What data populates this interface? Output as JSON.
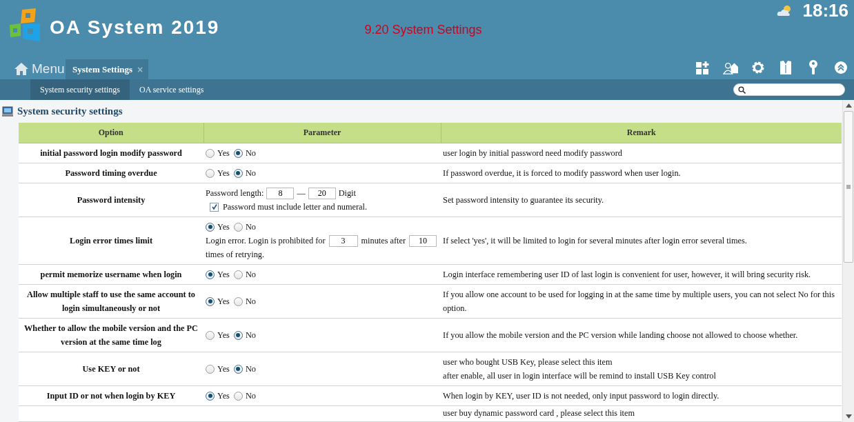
{
  "header": {
    "title": "OA System 2019",
    "page_title": "9.20 System Settings",
    "clock": "18:16"
  },
  "menu": {
    "label": "Menu"
  },
  "tabs": [
    {
      "label": "System Settings",
      "selected": true,
      "close": "×"
    }
  ],
  "subnav": [
    {
      "label": "System security settings",
      "selected": true
    },
    {
      "label": "OA service settings",
      "selected": false
    }
  ],
  "section": {
    "title": "System security settings"
  },
  "table": {
    "columns": [
      "Option",
      "Parameter",
      "Remark"
    ],
    "rows": [
      {
        "kind": "radio",
        "option": "initial password login modify password",
        "choices": [
          {
            "label": "Yes",
            "selected": false
          },
          {
            "label": "No",
            "selected": true
          }
        ],
        "remark": [
          "user login by initial password need modify password"
        ]
      },
      {
        "kind": "radio",
        "option": "Password timing overdue",
        "choices": [
          {
            "label": "Yes",
            "selected": false
          },
          {
            "label": "No",
            "selected": true
          }
        ],
        "remark": [
          "If password overdue, it is forced to modify password when user login."
        ]
      },
      {
        "kind": "length",
        "option": "Password intensity",
        "label": "Password length:",
        "min": "8",
        "dash": "—",
        "max": "20",
        "unit": "Digit",
        "check": {
          "label": "Password must include letter and numeral.",
          "checked": true
        },
        "remark": [
          "Set password intensity to guarantee its security."
        ]
      },
      {
        "kind": "limit",
        "option": "Login error times limit",
        "choices": [
          {
            "label": "Yes",
            "selected": true
          },
          {
            "label": "No",
            "selected": false
          }
        ],
        "text_before": "Login error. Login is prohibited for",
        "minutes": "3",
        "text_middle": "minutes after",
        "times": "10",
        "text_after": "times of retrying.",
        "remark": [
          "If select 'yes', it will be limited to login for several minutes after login error several times."
        ]
      },
      {
        "kind": "radio",
        "option": "permit memorize username when login",
        "choices": [
          {
            "label": "Yes",
            "selected": true
          },
          {
            "label": "No",
            "selected": false
          }
        ],
        "remark": [
          "Login interface remembering user ID of last login is convenient for user, however, it will bring security risk."
        ]
      },
      {
        "kind": "radio",
        "option": "Allow multiple staff to use the same account to login simultaneously or not",
        "choices": [
          {
            "label": "Yes",
            "selected": true
          },
          {
            "label": "No",
            "selected": false
          }
        ],
        "remark": [
          "If you allow one account to be used for logging in at the same time by multiple users, you can not select No for this option."
        ]
      },
      {
        "kind": "radio",
        "option": "Whether to allow the mobile version and the PC version at the same time log",
        "choices": [
          {
            "label": "Yes",
            "selected": false
          },
          {
            "label": "No",
            "selected": true
          }
        ],
        "remark": [
          "If you allow the mobile version and the PC version while landing choose not allowed to choose whether."
        ]
      },
      {
        "kind": "radio",
        "option": "Use KEY or not",
        "choices": [
          {
            "label": "Yes",
            "selected": false
          },
          {
            "label": "No",
            "selected": true
          }
        ],
        "remark": [
          "user who bought USB Key, please select this item",
          "after enable, all user in login interface will be remind to install USB Key control"
        ]
      },
      {
        "kind": "radio",
        "option": "Input ID or not when login by KEY",
        "choices": [
          {
            "label": "Yes",
            "selected": true
          },
          {
            "label": "No",
            "selected": false
          }
        ],
        "remark": [
          "When login by KEY, user ID is not needed, only input password to login directly."
        ]
      },
      {
        "kind": "partial",
        "remark": [
          "user buy dynamic password card , please select this item"
        ]
      }
    ]
  }
}
